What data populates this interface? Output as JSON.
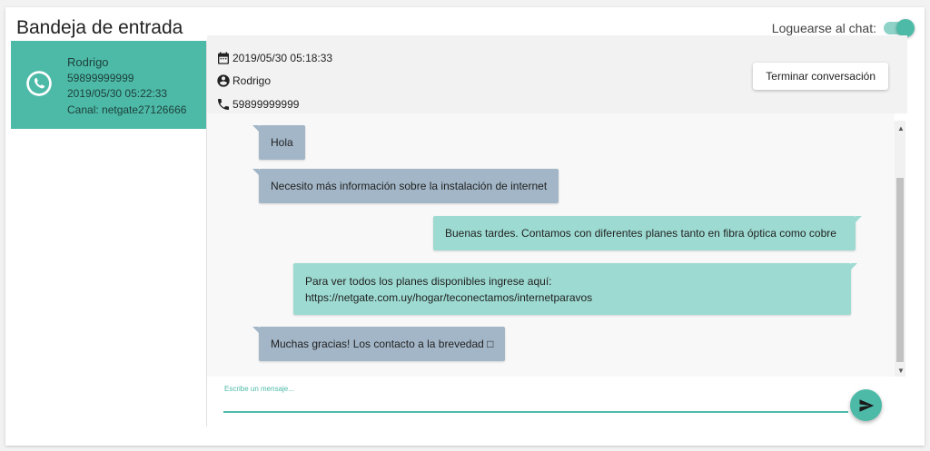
{
  "inbox": {
    "title": "Bandeja de entrada"
  },
  "chat_toggle": {
    "label": "Loguearse al chat:",
    "on": true
  },
  "contacts": [
    {
      "name": "Rodrigo",
      "phone": "59899999999",
      "datetime": "2019/05/30 05:22:33",
      "channel": "Canal: netgate27126666",
      "icon": "whatsapp-icon"
    }
  ],
  "conversation": {
    "datetime": "2019/05/30 05:18:33",
    "name": "Rodrigo",
    "phone": "59899999999",
    "end_button": "Terminar conversación"
  },
  "messages": [
    {
      "direction": "in",
      "text": "Hola"
    },
    {
      "direction": "in",
      "text": "Necesito más información sobre la instalación de internet"
    },
    {
      "direction": "out",
      "text": "Buenas tardes. Contamos con diferentes planes tanto en fibra óptica como cobre"
    },
    {
      "direction": "out",
      "line1": "Para ver todos los planes disponibles ingrese aquí:",
      "line2": "https://netgate.com.uy/hogar/teconectamos/internetparavos"
    },
    {
      "direction": "in",
      "text": "Muchas gracias! Los contacto a la brevedad □"
    }
  ],
  "composer": {
    "placeholder": "Escribe un mensaje...",
    "value": ""
  },
  "colors": {
    "accent": "#4dbaa8",
    "incoming": "#a2b6c7",
    "outgoing": "#9ddbd2"
  }
}
